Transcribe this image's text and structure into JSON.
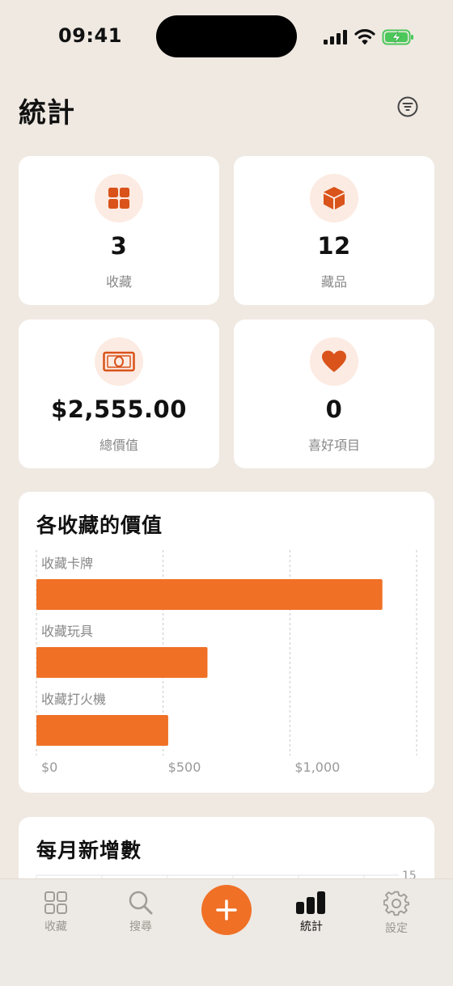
{
  "status_bar": {
    "time": "09:41"
  },
  "header": {
    "title": "統計"
  },
  "stats": [
    {
      "value": "3",
      "label": "收藏",
      "icon": "grid-icon"
    },
    {
      "value": "12",
      "label": "藏品",
      "icon": "box-icon"
    },
    {
      "value": "$2,555.00",
      "label": "總價值",
      "icon": "banknote-icon"
    },
    {
      "value": "0",
      "label": "喜好項目",
      "icon": "heart-icon"
    }
  ],
  "value_chart": {
    "title": "各收藏的價值",
    "chart_data": {
      "type": "bar",
      "orientation": "horizontal",
      "categories": [
        "收藏卡牌",
        "收藏玩具",
        "收藏打火機"
      ],
      "values": [
        1365,
        675,
        520
      ],
      "xlim": [
        0,
        1500
      ],
      "tick_values": [
        0,
        500,
        1000
      ],
      "tick_labels": [
        "$0",
        "$500",
        "$1,000"
      ],
      "grid": true,
      "color": "#F07026"
    }
  },
  "monthly_chart": {
    "title": "每月新增數",
    "y_tick_label": "15"
  },
  "tabs": [
    {
      "label": "收藏",
      "icon": "grid-icon"
    },
    {
      "label": "搜尋",
      "icon": "search-icon"
    },
    {
      "label": "統計",
      "icon": "bar-chart-icon"
    },
    {
      "label": "設定",
      "icon": "gear-icon"
    }
  ],
  "colors": {
    "accent": "#F07026",
    "badge_bg": "#FCEBE2",
    "background": "#EFE9E2"
  }
}
